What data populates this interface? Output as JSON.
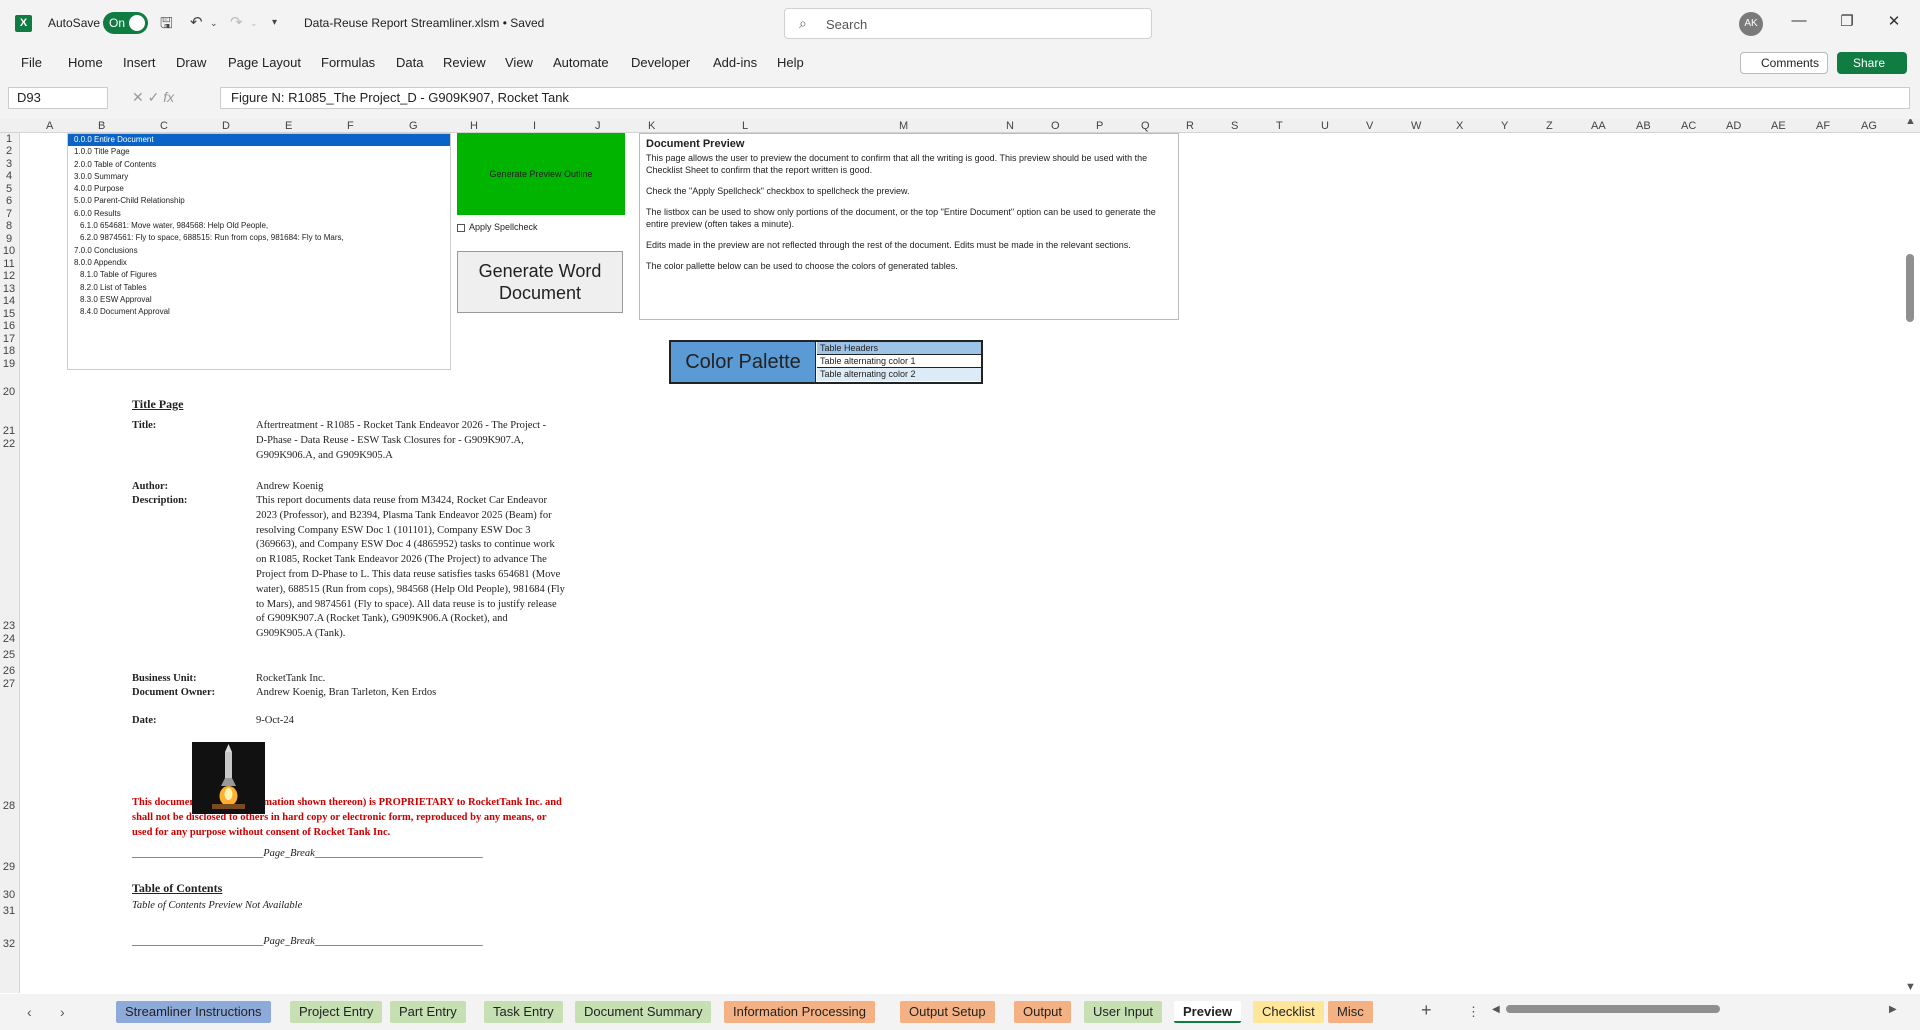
{
  "titlebar": {
    "autosave_label": "AutoSave",
    "autosave_state": "On",
    "doc_title": "Data-Reuse Report Streamliner.xlsm • Saved",
    "search_placeholder": "Search",
    "avatar_initials": "AK"
  },
  "menu": [
    "File",
    "Home",
    "Insert",
    "Draw",
    "Page Layout",
    "Formulas",
    "Data",
    "Review",
    "View",
    "Automate",
    "Developer",
    "Add-ins",
    "Help"
  ],
  "comments_label": "Comments",
  "share_label": "Share",
  "formula_bar": {
    "name_box": "D93",
    "formula": "Figure N: R1085_The Project_D - G909K907, Rocket Tank"
  },
  "columns": [
    "A",
    "B",
    "C",
    "D",
    "E",
    "F",
    "G",
    "H",
    "I",
    "J",
    "K",
    "L",
    "M",
    "N",
    "O",
    "P",
    "Q",
    "R",
    "S",
    "T",
    "U",
    "V",
    "W",
    "X",
    "Y",
    "Z",
    "AA",
    "AB",
    "AC",
    "AD",
    "AE",
    "AF",
    "AG"
  ],
  "rows": [
    "1",
    "2",
    "3",
    "4",
    "5",
    "6",
    "7",
    "8",
    "9",
    "10",
    "11",
    "12",
    "13",
    "14",
    "15",
    "16",
    "17",
    "18",
    "19",
    "20",
    "21",
    "22",
    "23",
    "24",
    "25",
    "26",
    "27",
    "28",
    "29",
    "30",
    "31",
    "32"
  ],
  "listbox": [
    "0.0.0 Entire Document",
    "1.0.0 Title Page",
    "2.0.0 Table of Contents",
    "3.0.0 Summary",
    "4.0.0 Purpose",
    "5.0.0 Parent-Child Relationship",
    "6.0.0 Results",
    "6.1.0 654681: Move water, 984568: Help Old People,",
    "6.2.0 9874561: Fly to space, 688515: Run from cops, 981684: Fly to Mars,",
    "7.0.0 Conclusions",
    "8.0.0 Appendix",
    "8.1.0 Table of Figures",
    "8.2.0 List of Tables",
    "8.3.0 ESW Approval",
    "8.4.0 Document Approval"
  ],
  "generate_outline_label": "Generate Preview Outline",
  "apply_spellcheck_label": "Apply Spellcheck",
  "generate_word_label": "Generate Word Document",
  "info": {
    "title": "Document Preview",
    "paragraphs": [
      "This page allows the user to preview the document to confirm that all the writing is good. This preview should be used with the Checklist Sheet to confirm that the report written is good.",
      "Check the \"Apply Spellcheck\" checkbox to spellcheck the preview.",
      "The listbox can be used to show only portions of the document, or the top \"Entire Document\" option can be used to generate the entire preview (often takes a minute).",
      "Edits made in the preview are not reflected through the rest of the document. Edits must be made in the relevant sections.",
      "The color pallette below can be used to choose the colors of generated tables."
    ]
  },
  "palette": {
    "title": "Color Palette",
    "rows": [
      "Table Headers",
      "Table alternating color 1",
      "Table alternating color 2"
    ],
    "colors": [
      "#9dc3e6",
      "#ffffff",
      "#ddebf7"
    ]
  },
  "doc": {
    "title_page_heading": "Title Page",
    "title_label": "Title:",
    "title_value": "Aftertreatment - R1085 - Rocket Tank Endeavor 2026 - The Project - D-Phase - Data Reuse - ESW Task Closures for - G909K907.A, G909K906.A, and G909K905.A",
    "author_label": "Author:",
    "author_value": "Andrew Koenig",
    "description_label": "Description:",
    "description_value": "This report documents data reuse from M3424, Rocket Car Endeavor 2023 (Professor), and B2394, Plasma Tank Endeavor 2025 (Beam) for resolving Company ESW Doc 1 (101101), Company ESW Doc 3 (369663), and Company ESW Doc 4 (4865952) tasks to continue work on R1085, Rocket Tank Endeavor 2026 (The Project) to advance The Project from D-Phase to L. This data reuse satisfies tasks 654681 (Move water), 688515 (Run from cops), 984568 (Help Old People), 981684 (Fly to Mars), and 9874561 (Fly to space). All data reuse is to justify release of G909K907.A (Rocket Tank), G909K906.A (Rocket), and G909K905.A (Tank).",
    "bu_label": "Business Unit:",
    "bu_value": "RocketTank Inc.",
    "owner_label": "Document Owner:",
    "owner_value": "Andrew Koenig, Bran Tarleton, Ken Erdos",
    "date_label": "Date:",
    "date_value": "9-Oct-24",
    "proprietary": "This document (and the information shown thereon) is PROPRIETARY to RocketTank Inc. and shall not be disclosed to others in hard copy or electronic form, reproduced by any means, or used for any purpose without consent of Rocket Tank Inc.",
    "page_break": "_________________________Page_Break________________________________",
    "toc_heading": "Table of Contents",
    "toc_note": "Table of Contents Preview Not Available"
  },
  "tabs": [
    {
      "label": "Streamliner Instructions",
      "color": "#8eaadb"
    },
    {
      "label": "Project Entry",
      "color": "#c6e0b4"
    },
    {
      "label": "Part Entry",
      "color": "#c6e0b4"
    },
    {
      "label": "Task Entry",
      "color": "#c6e0b4"
    },
    {
      "label": "Document Summary",
      "color": "#c6e0b4"
    },
    {
      "label": "Information Processing",
      "color": "#f4b183"
    },
    {
      "label": "Output Setup",
      "color": "#f4b183"
    },
    {
      "label": "Output",
      "color": "#f4b183"
    },
    {
      "label": "User Input",
      "color": "#c6e0b4"
    },
    {
      "label": "Preview",
      "color": "#ffffff"
    },
    {
      "label": "Checklist",
      "color": "#ffe699"
    },
    {
      "label": "Misc",
      "color": "#f4b183"
    }
  ]
}
